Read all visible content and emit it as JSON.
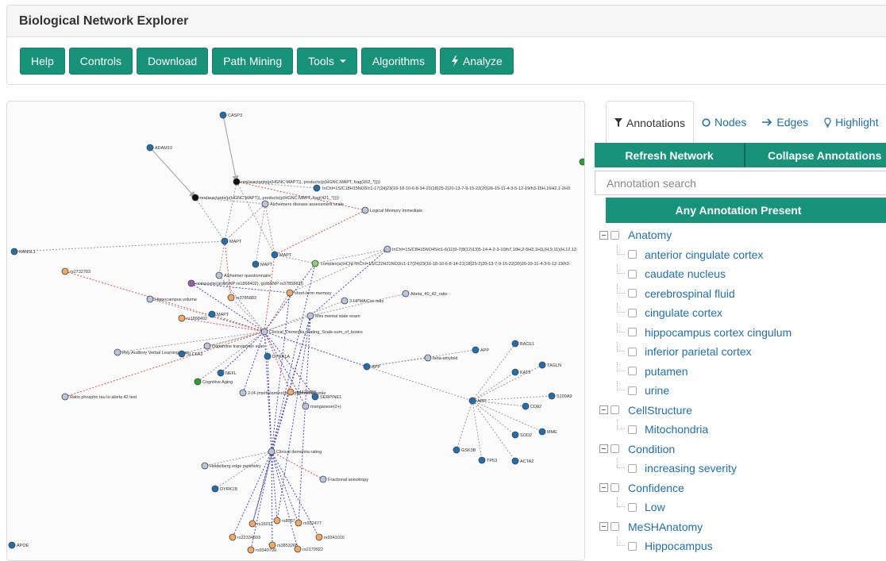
{
  "app": {
    "title": "Biological Network Explorer",
    "accent_color": "#18937a"
  },
  "toolbar": {
    "buttons": [
      {
        "label": "Help"
      },
      {
        "label": "Controls"
      },
      {
        "label": "Download"
      },
      {
        "label": "Path Mining"
      },
      {
        "label": "Tools",
        "dropdown": true
      },
      {
        "label": "Algorithms"
      },
      {
        "label": "Analyze",
        "icon": "lightning-icon"
      }
    ]
  },
  "side_panel": {
    "tabs": [
      {
        "label": "Annotations",
        "icon": "filter-icon",
        "active": true
      },
      {
        "label": "Nodes",
        "icon": "circle-icon"
      },
      {
        "label": "Edges",
        "icon": "arrow-right-icon"
      },
      {
        "label": "Highlight",
        "icon": "lightbulb-icon"
      }
    ],
    "refresh_label": "Refresh Network",
    "collapse_label": "Collapse Annotations",
    "search_placeholder": "Annotation search",
    "any_annotation_label": "Any Annotation Present",
    "groups": [
      {
        "name": "Anatomy",
        "items": [
          "anterior cingulate cortex",
          "caudate nucleus",
          "cerebrospinal fluid",
          "cingulate cortex",
          "hippocampus cortex cingulum",
          "inferior parietal cortex",
          "putamen",
          "urine"
        ]
      },
      {
        "name": "CellStructure",
        "items": [
          "Mitochondria"
        ]
      },
      {
        "name": "Condition",
        "items": [
          "increasing severity"
        ]
      },
      {
        "name": "Confidence",
        "items": [
          "Low"
        ]
      },
      {
        "name": "MeSHAnatomy",
        "items": [
          "Hippocampus"
        ]
      }
    ]
  },
  "network": {
    "node_colors": {
      "protein": "#1f6fb0",
      "pathology": "#b8c4e0",
      "snp": "#f4a860",
      "reaction": "#111111",
      "complex": "#8fd16f",
      "composite": "#9b59b6",
      "bioprocess": "#2ca02c"
    },
    "edge_colors": {
      "increases": "#e05050",
      "decreases": "#4a4ac0",
      "association": "#999999"
    },
    "nodes": [
      {
        "id": "casp3",
        "label": "CASP3",
        "type": "protein"
      },
      {
        "id": "adam10",
        "label": "ADAM10",
        "type": "protein"
      },
      {
        "id": "rxn1",
        "label": "rxn(reactants(p(HGNC:MAPT)), products(p(HGNC:MAPT, frag(152_*))))",
        "type": "reaction"
      },
      {
        "id": "rxn2",
        "label": "rxn(reactants(p(HGNC:MAPT)), products(p(HGNC:MAPT, frag(421_*))))",
        "type": "reaction"
      },
      {
        "id": "inchi1",
        "label": "InChI=1S/C18H15NO3/c1-17(24)23(16-18-10-6-8-14-21(18)25-2)20-13-7-9-15-22(20)26-19-11-4-3-5-12-19/h3-15H,16H2,1-2H3",
        "type": "protein"
      },
      {
        "id": "ada",
        "label": "Alzheimers disease assessment scale",
        "type": "pathology"
      },
      {
        "id": "lmi",
        "label": "Logical Memory Immediate",
        "type": "pathology"
      },
      {
        "id": "kansl1",
        "label": "KANSL1",
        "type": "protein"
      },
      {
        "id": "mapt1",
        "label": "MAPT",
        "type": "protein"
      },
      {
        "id": "mapt2",
        "label": "MAPT",
        "type": "protein"
      },
      {
        "id": "mapt3",
        "label": "MAPT",
        "type": "protein"
      },
      {
        "id": "inchi2",
        "label": "InChI=1S/C8H15NO4S/c1-6(11)9-7(8(12)13)5-14-4-2-3-10/h7,10H,2-5H2,1H3,(H,9,11)(H,12,13",
        "type": "pathology"
      },
      {
        "id": "rs2732703",
        "label": "rs2732703",
        "type": "snp"
      },
      {
        "id": "complex1",
        "label": "complex(a(InChI:\"InChI=1S/C22H21NO3/c1-17(24)23(16-18-10-6-8-14-21(18)25-2)20-13-7-9-15-22(20)26-19-11-4-3-5-12-19/h3-",
        "type": "complex"
      },
      {
        "id": "aq",
        "label": "Alzheimer questionnaire",
        "type": "pathology"
      },
      {
        "id": "composite1",
        "label": "composite(g(dbSNP:rs1868402), g(dbSNP:rs3785883))",
        "type": "composite"
      },
      {
        "id": "stm",
        "label": "short-term memory",
        "type": "snp"
      },
      {
        "id": "hv",
        "label": "Hippocampus volume",
        "type": "pathology"
      },
      {
        "id": "rs3785883",
        "label": "rs3785883",
        "type": "snp"
      },
      {
        "id": "hpma",
        "label": "3-HPMA/Cre ratio",
        "type": "pathology"
      },
      {
        "id": "abeta",
        "label": "Abeta_40_42_ratio",
        "type": "pathology"
      },
      {
        "id": "rs1868402",
        "label": "rs1868402",
        "type": "snp"
      },
      {
        "id": "mapt4",
        "label": "MAPT",
        "type": "protein"
      },
      {
        "id": "mmse",
        "label": "Mini mental state exam",
        "type": "pathology"
      },
      {
        "id": "cdr_sob",
        "label": "Clinical_Dementia_Rating_Scale-sum_of_boxes",
        "type": "pathology"
      },
      {
        "id": "dat",
        "label": "Dopamine transporter scan",
        "type": "pathology"
      },
      {
        "id": "ravlt",
        "label": "Rey Auditory Verbal Learning Test",
        "type": "pathology"
      },
      {
        "id": "slc6a3",
        "label": "SLC6A3",
        "type": "protein"
      },
      {
        "id": "dyrk1a",
        "label": "DYRK1A",
        "type": "protein"
      },
      {
        "id": "app1",
        "label": "APP",
        "type": "protein"
      },
      {
        "id": "ba",
        "label": "beta-amyloid",
        "type": "pathology"
      },
      {
        "id": "app2",
        "label": "APP",
        "type": "protein"
      },
      {
        "id": "bace1",
        "label": "BACE1",
        "type": "protein"
      },
      {
        "id": "kat5",
        "label": "KAT5",
        "type": "protein"
      },
      {
        "id": "tagln",
        "label": "TAGLN",
        "type": "protein"
      },
      {
        "id": "nefl",
        "label": "NEFL",
        "type": "protein"
      },
      {
        "id": "ca",
        "label": "Cognitive Aging",
        "type": "bioprocess"
      },
      {
        "id": "ratio",
        "label": "Ratio phospho tau to abeta 42 test",
        "type": "pathology"
      },
      {
        "id": "mbz",
        "label": "2-(4-(methylamino)phenyl)benzothiazole",
        "type": "pathology"
      },
      {
        "id": "snp_overlap",
        "label": "rs4420638",
        "type": "snp"
      },
      {
        "id": "serpine1",
        "label": "SERPINE1",
        "type": "protein"
      },
      {
        "id": "mn",
        "label": "manganese(2+)",
        "type": "pathology"
      },
      {
        "id": "app3",
        "label": "APP",
        "type": "protein"
      },
      {
        "id": "s100a9",
        "label": "S100A9",
        "type": "protein"
      },
      {
        "id": "cd82",
        "label": "CD82",
        "type": "protein"
      },
      {
        "id": "mme",
        "label": "MME",
        "type": "protein"
      },
      {
        "id": "sod2",
        "label": "SOD2",
        "type": "protein"
      },
      {
        "id": "gsk3b",
        "label": "GSK3B",
        "type": "protein"
      },
      {
        "id": "tp53",
        "label": "TP53",
        "type": "protein"
      },
      {
        "id": "acta2",
        "label": "ACTA2",
        "type": "protein"
      },
      {
        "id": "cdr",
        "label": "Clinical dementia rating",
        "type": "pathology"
      },
      {
        "id": "hep",
        "label": "Heidelberg edge perimetry",
        "type": "pathology"
      },
      {
        "id": "fa",
        "label": "Fractional anisotropy",
        "type": "pathology"
      },
      {
        "id": "dyrk1b",
        "label": "DYRK1B",
        "type": "protein"
      },
      {
        "id": "rs16011",
        "label": "rs16011",
        "type": "snp"
      },
      {
        "id": "rs8087",
        "label": "rs8087",
        "type": "snp"
      },
      {
        "id": "rs932477",
        "label": "rs932477",
        "type": "snp"
      },
      {
        "id": "rs22334693",
        "label": "rs22334693",
        "type": "snp"
      },
      {
        "id": "rs9341016",
        "label": "rs9341016",
        "type": "snp"
      },
      {
        "id": "rs3853268",
        "label": "rs3853268",
        "type": "snp"
      },
      {
        "id": "rs9340799",
        "label": "rs9340799",
        "type": "snp"
      },
      {
        "id": "rs2179922",
        "label": "rs2179922",
        "type": "snp"
      },
      {
        "id": "apoe",
        "label": "APOE",
        "type": "protein"
      },
      {
        "id": "edge_green",
        "label": "",
        "type": "bioprocess"
      }
    ]
  }
}
